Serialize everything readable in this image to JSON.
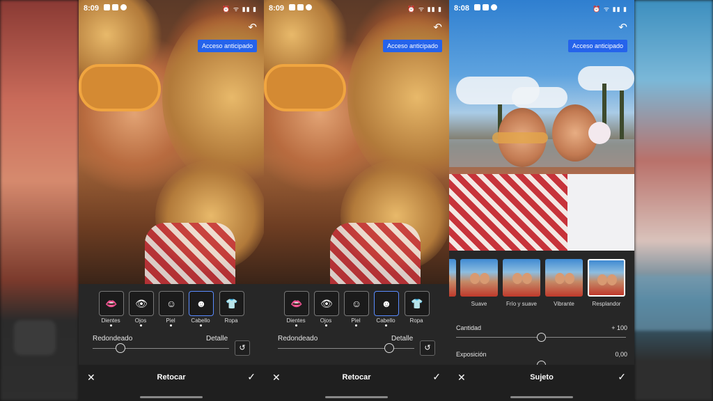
{
  "status_times": [
    "8:09",
    "8:09",
    "8:08"
  ],
  "early_access": "Acceso anticipado",
  "retouch": {
    "tools": [
      "Dientes",
      "Ojos",
      "Piel",
      "Cabello",
      "Ropa"
    ],
    "left_label": "Redondeado",
    "right_label": "Detalle",
    "title": "Retocar",
    "slider_level_p1": 0.2,
    "slider_level_p2": 0.81
  },
  "subject": {
    "title": "Sujeto",
    "presets": [
      "ste",
      "Suave",
      "Frío y suave",
      "Vibrante",
      "Resplandor"
    ],
    "selected_preset": "Resplandor",
    "adjust": [
      {
        "label": "Cantidad",
        "value": "+ 100"
      },
      {
        "label": "Exposición",
        "value": "0,00"
      }
    ]
  }
}
